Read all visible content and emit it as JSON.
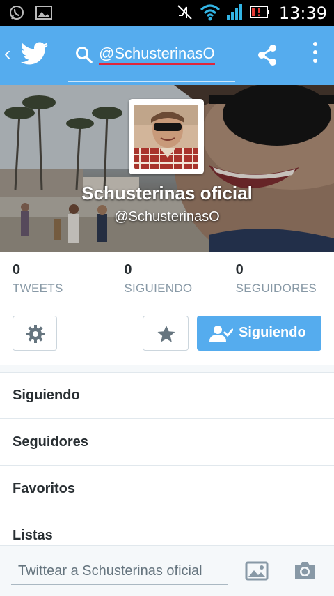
{
  "status_bar": {
    "time": "13:39",
    "icons": [
      "whatsapp-icon",
      "gallery-icon",
      "vibrate-off-icon",
      "wifi-icon",
      "signal-icon",
      "battery-alert-icon"
    ]
  },
  "action_bar": {
    "search_query": "@SchusterinasO",
    "icons": [
      "back-chevron-icon",
      "twitter-bird-icon",
      "search-icon",
      "share-icon",
      "overflow-menu-icon"
    ],
    "accent_color": "#55acee"
  },
  "profile": {
    "name": "Schusterinas oficial",
    "handle": "@SchusterinasO"
  },
  "stats": [
    {
      "count": "0",
      "label": "TWEETS"
    },
    {
      "count": "0",
      "label": "SIGUIENDO"
    },
    {
      "count": "0",
      "label": "SEGUIDORES"
    }
  ],
  "actions": {
    "settings_icon": "gear-icon",
    "favorite_icon": "star-icon",
    "follow_label": "Siguiendo",
    "follow_icon": "following-user-icon"
  },
  "menu": [
    {
      "label": "Siguiendo"
    },
    {
      "label": "Seguidores"
    },
    {
      "label": "Favoritos"
    },
    {
      "label": "Listas"
    }
  ],
  "compose": {
    "placeholder": "Twittear a Schusterinas oficial",
    "icons": [
      "image-icon",
      "camera-icon"
    ]
  }
}
